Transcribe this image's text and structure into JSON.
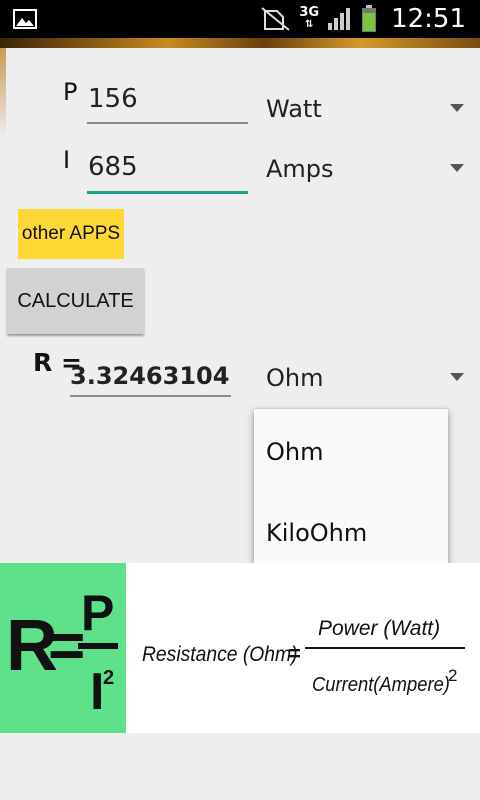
{
  "status_bar": {
    "network": "3G",
    "time": "12:51"
  },
  "inputs": {
    "p_label": "P",
    "p_value": "156",
    "p_unit": "Watt",
    "i_label": "I",
    "i_value": "685",
    "i_unit": "Amps"
  },
  "buttons": {
    "other_apps": "other APPS",
    "calculate": "CALCULATE"
  },
  "result": {
    "label": "R =",
    "value": "3.324631040!",
    "unit": "Ohm"
  },
  "dropdown": {
    "options": [
      "Ohm",
      "KiloOhm"
    ]
  },
  "formula": {
    "big_r": "R",
    "big_eq": "=",
    "big_p": "P",
    "big_i": "I",
    "big_sup": "2",
    "resistance_text": "Resistance (Ohm)",
    "equals": "=",
    "numerator": "Power (Watt)",
    "denominator": "Current(Ampere)",
    "denominator_sup": "2"
  },
  "colors": {
    "accent_underline": "#1e9c8c",
    "other_apps_bg": "#fdd835",
    "formula_green": "#5fe08a"
  }
}
